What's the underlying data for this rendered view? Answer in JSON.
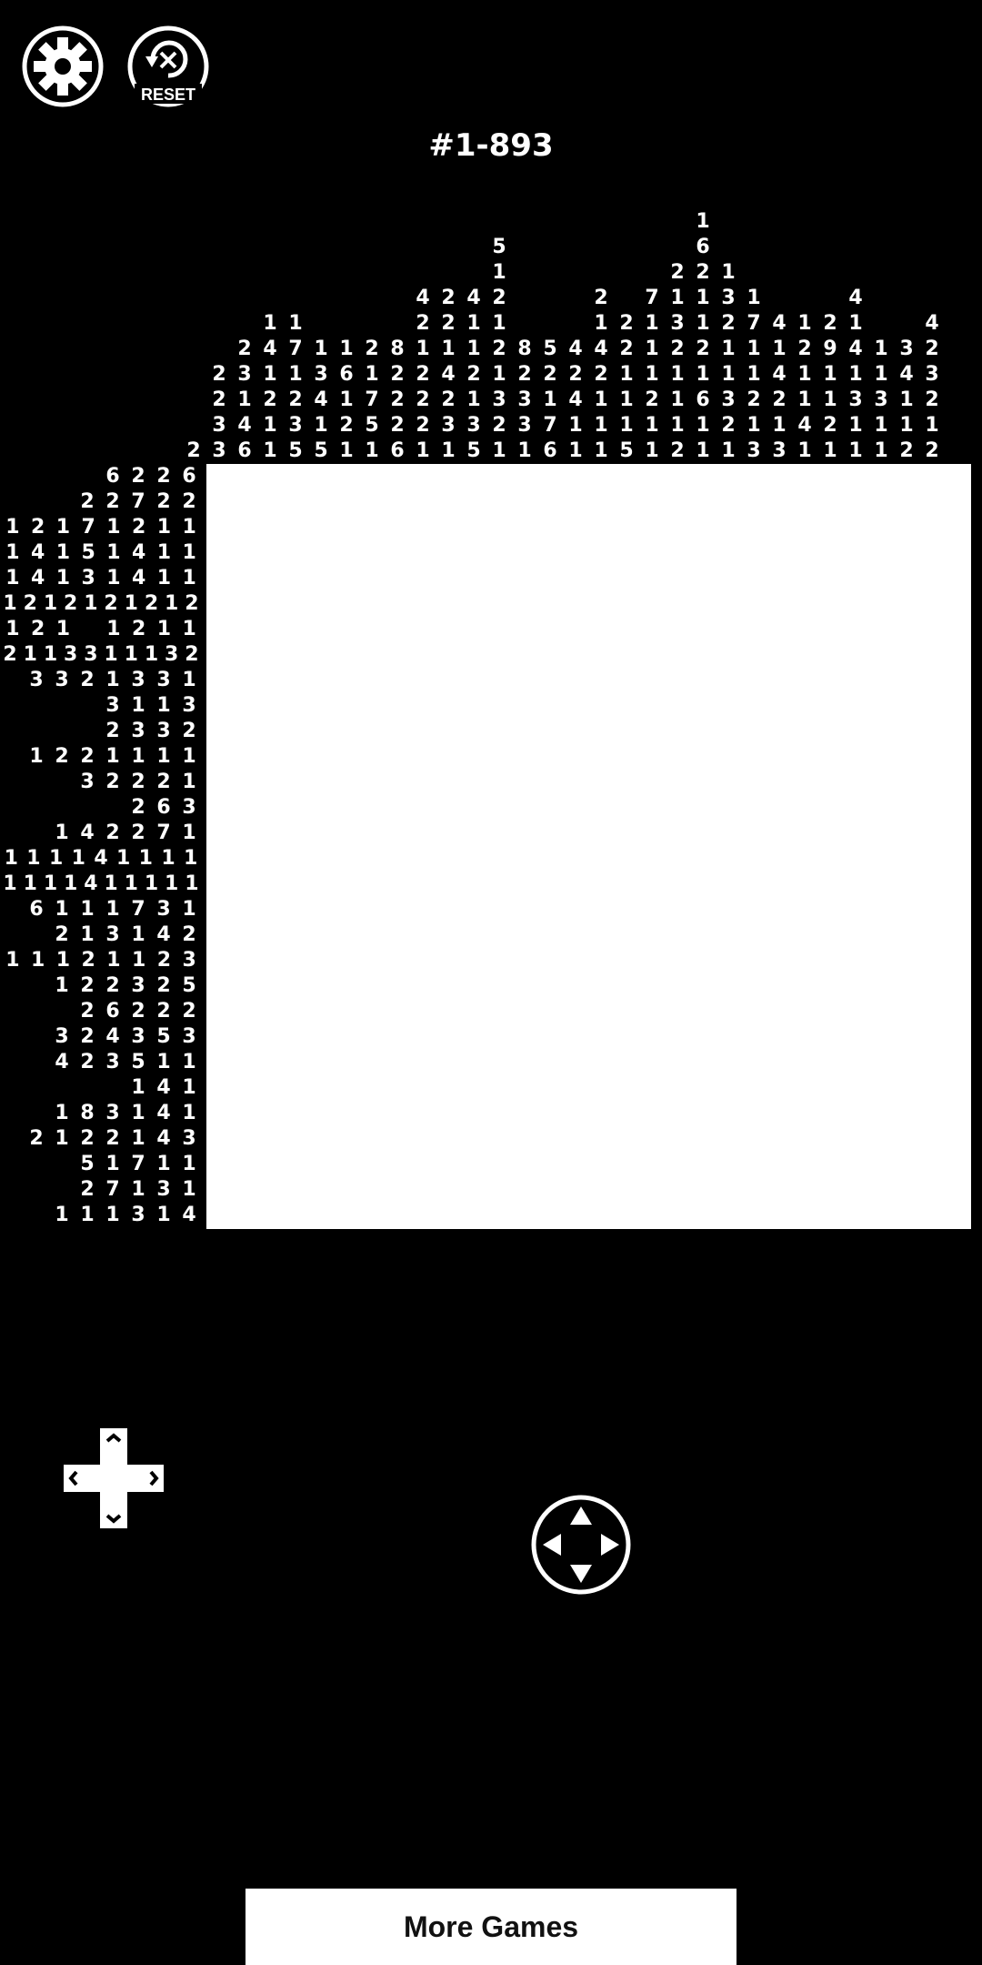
{
  "header": {
    "settings_icon": "gear-icon",
    "reset_icon": "reset-icon",
    "reset_label": "RESET"
  },
  "puzzle": {
    "title": "#1-893",
    "column_clues": [
      [
        "2"
      ],
      [
        "2",
        "2",
        "3",
        "3"
      ],
      [
        "2",
        "3",
        "1",
        "4",
        "6"
      ],
      [
        "1",
        "4",
        "1",
        "2",
        "1",
        "1"
      ],
      [
        "1",
        "7",
        "1",
        "2",
        "3",
        "5"
      ],
      [
        "1",
        "3",
        "4",
        "1",
        "5"
      ],
      [
        "1",
        "6",
        "1",
        "2",
        "1"
      ],
      [
        "2",
        "1",
        "7",
        "5",
        "1"
      ],
      [
        "8",
        "2",
        "2",
        "2",
        "6"
      ],
      [
        "4",
        "2",
        "1",
        "2",
        "2",
        "2",
        "1"
      ],
      [
        "2",
        "2",
        "1",
        "4",
        "2",
        "3",
        "1"
      ],
      [
        "4",
        "1",
        "1",
        "2",
        "1",
        "3",
        "5"
      ],
      [
        "5",
        "1",
        "2",
        "1",
        "2",
        "1",
        "3",
        "2",
        "1"
      ],
      [
        "8",
        "2",
        "3",
        "3",
        "1"
      ],
      [
        "5",
        "2",
        "1",
        "7",
        "6"
      ],
      [
        "4",
        "2",
        "4",
        "1",
        "1"
      ],
      [
        "2",
        "1",
        "4",
        "2",
        "1",
        "1",
        "1"
      ],
      [
        "2",
        "2",
        "1",
        "1",
        "1",
        "5"
      ],
      [
        "7",
        "1",
        "1",
        "1",
        "2",
        "1",
        "1"
      ],
      [
        "2",
        "1",
        "3",
        "2",
        "1",
        "1",
        "1",
        "2"
      ],
      [
        "1",
        "6",
        "2",
        "1",
        "1",
        "2",
        "1",
        "6",
        "1",
        "1"
      ],
      [
        "1",
        "3",
        "2",
        "1",
        "1",
        "3",
        "2",
        "1"
      ],
      [
        "1",
        "7",
        "1",
        "1",
        "2",
        "1",
        "3"
      ],
      [
        "4",
        "1",
        "4",
        "2",
        "1",
        "3"
      ],
      [
        "1",
        "2",
        "1",
        "1",
        "4",
        "1"
      ],
      [
        "2",
        "9",
        "1",
        "1",
        "2",
        "1"
      ],
      [
        "4",
        "1",
        "4",
        "1",
        "3",
        "1",
        "1"
      ],
      [
        "1",
        "1",
        "3",
        "1",
        "1"
      ],
      [
        "3",
        "4",
        "1",
        "1",
        "2"
      ],
      [
        "4",
        "2",
        "3",
        "2",
        "1",
        "2"
      ]
    ],
    "row_clues": [
      [
        "6",
        "2",
        "2",
        "6"
      ],
      [
        "2",
        "2",
        "7",
        "2",
        "2"
      ],
      [
        "1",
        "2",
        "1",
        "7",
        "1",
        "2",
        "1",
        "1"
      ],
      [
        "1",
        "4",
        "1",
        "5",
        "1",
        "4",
        "1",
        "1"
      ],
      [
        "1",
        "4",
        "1",
        "3",
        "1",
        "4",
        "1",
        "1"
      ],
      [
        "1",
        "2",
        "1",
        "2",
        "1",
        "2",
        "1",
        "2",
        "1",
        "2"
      ],
      [
        "1",
        "2",
        "1",
        "",
        "1",
        "2",
        "1",
        "1"
      ],
      [
        "2",
        "1",
        "1",
        "3",
        "3",
        "1",
        "1",
        "1",
        "3",
        "2"
      ],
      [
        "3",
        "3",
        "2",
        "1",
        "3",
        "3",
        "1"
      ],
      [
        "3",
        "1",
        "1",
        "3"
      ],
      [
        "2",
        "3",
        "3",
        "2"
      ],
      [
        "1",
        "2",
        "2",
        "1",
        "1",
        "1",
        "1"
      ],
      [
        "3",
        "2",
        "2",
        "2",
        "1"
      ],
      [
        "2",
        "6",
        "3"
      ],
      [
        "1",
        "4",
        "2",
        "2",
        "7",
        "1"
      ],
      [
        "1",
        "1",
        "1",
        "1",
        "4",
        "1",
        "1",
        "1",
        "1"
      ],
      [
        "1",
        "1",
        "1",
        "1",
        "4",
        "1",
        "1",
        "1",
        "1",
        "1"
      ],
      [
        "6",
        "1",
        "1",
        "1",
        "7",
        "3",
        "1"
      ],
      [
        "2",
        "1",
        "3",
        "1",
        "4",
        "2"
      ],
      [
        "1",
        "1",
        "1",
        "2",
        "1",
        "1",
        "2",
        "3"
      ],
      [
        "1",
        "2",
        "2",
        "3",
        "2",
        "5"
      ],
      [
        "2",
        "6",
        "2",
        "2",
        "2"
      ],
      [
        "3",
        "2",
        "4",
        "3",
        "5",
        "3"
      ],
      [
        "4",
        "2",
        "3",
        "5",
        "1",
        "1"
      ],
      [
        "1",
        "4",
        "1"
      ],
      [
        "1",
        "8",
        "3",
        "1",
        "4",
        "1"
      ],
      [
        "2",
        "1",
        "2",
        "2",
        "1",
        "4",
        "3"
      ],
      [
        "5",
        "1",
        "7",
        "1",
        "1"
      ],
      [
        "2",
        "7",
        "1",
        "3",
        "1"
      ],
      [
        "1",
        "1",
        "1",
        "3",
        "1",
        "4"
      ]
    ]
  },
  "controls": {
    "dpad_icon": "dpad-icon",
    "joystick_icon": "joystick-icon"
  },
  "footer": {
    "more_games_label": "More Games"
  }
}
